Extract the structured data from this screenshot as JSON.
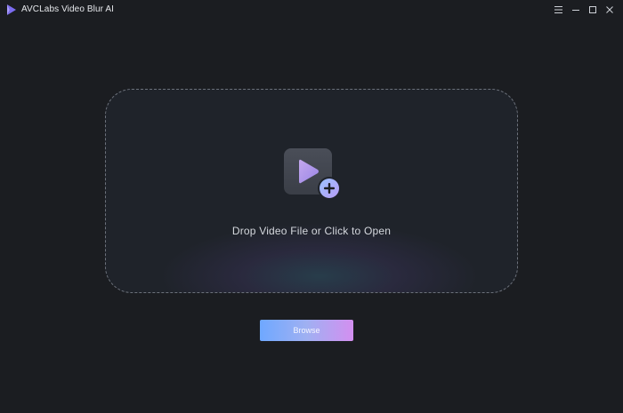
{
  "window": {
    "title": "AVCLabs Video Blur AI",
    "controls": [
      {
        "name": "menu-icon"
      },
      {
        "name": "minimize-icon"
      },
      {
        "name": "maximize-icon"
      },
      {
        "name": "close-icon"
      }
    ]
  },
  "dropzone": {
    "text": "Drop Video File or Click to Open",
    "icon": "video-add-icon"
  },
  "browse": {
    "label": "Browse"
  },
  "colors": {
    "background": "#1b1d21",
    "dropzone_bg": "#1f232a",
    "border": "#6c717b",
    "accent_start": "#6fa8ff",
    "accent_end": "#d38ff0",
    "logo": "#7b6cf0"
  }
}
